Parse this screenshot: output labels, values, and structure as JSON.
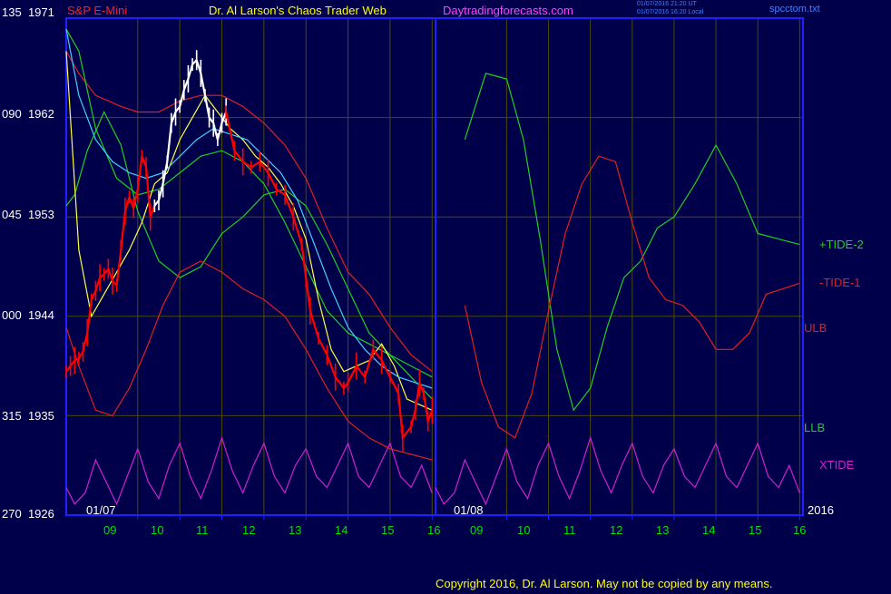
{
  "header": {
    "symbol": "S&P E-Mini",
    "title": "Dr. Al Larson's Chaos Trader Web",
    "site": "Daytradingforecasts.com",
    "timestamp_ut": "01/07/2016 21:20 UT",
    "timestamp_local": "01/07/2016 16:20 Local",
    "file": "spcctom.txt"
  },
  "copyright": "Copyright 2016, Dr. Al Larson. May not be copied by any means.",
  "legend": {
    "tide2": "+TIDE-2",
    "tide1": "-TIDE-1",
    "ulb": "ULB",
    "llb": "LLB",
    "xtide": "XTIDE"
  },
  "colors": {
    "background": "#00004a",
    "frame": "#2020ff",
    "grid": "#4a4a10",
    "price_up": "#ffffff",
    "price_down": "#ff0000",
    "tide2": "#20d020",
    "tide1": "#e02020",
    "xtide": "#d020d0",
    "llb": "#20d020",
    "fast_avg": "#ffff40",
    "slow_avg": "#40d0ff",
    "header_symbol": "#ff2020",
    "header_title": "#ffff00",
    "header_site": "#ff40ff",
    "header_small": "#4080ff"
  },
  "chart_data": {
    "type": "line",
    "title": "S&P E-Mini",
    "y_axis": {
      "range": [
        1926,
        1971
      ],
      "ticks": [
        {
          "left": "135",
          "right": "1971"
        },
        {
          "left": "090",
          "right": "1962"
        },
        {
          "left": "045",
          "right": "1953"
        },
        {
          "left": "000",
          "right": "1944"
        },
        {
          "left": "315",
          "right": "1935"
        },
        {
          "left": "270",
          "right": "1926"
        }
      ]
    },
    "x_axis": {
      "unit": "hour",
      "range": [
        7.3,
        16.08
      ],
      "ticks": [
        {
          "label": "09",
          "x": 9
        },
        {
          "label": "10",
          "x": 10
        },
        {
          "label": "11",
          "x": 11
        },
        {
          "label": "12",
          "x": 12
        },
        {
          "label": "13",
          "x": 13
        },
        {
          "label": "14",
          "x": 14
        },
        {
          "label": "15",
          "x": 15
        },
        {
          "label": "16",
          "x": 16
        },
        {
          "label": "09",
          "x": 9
        },
        {
          "label": "10",
          "x": 10
        },
        {
          "label": "11",
          "x": 11
        },
        {
          "label": "12",
          "x": 12
        },
        {
          "label": "13",
          "x": 13
        },
        {
          "label": "14",
          "x": 14
        },
        {
          "label": "15",
          "x": 15
        },
        {
          "label": "16",
          "x": 16
        }
      ],
      "date_labels": [
        "01/07",
        "01/08",
        "2016"
      ]
    },
    "price_segments": [
      {
        "color": "down",
        "points": [
          [
            7.3,
            1939.0
          ],
          [
            7.4,
            1939.5
          ],
          [
            7.5,
            1940.0
          ],
          [
            7.6,
            1940.2
          ],
          [
            7.7,
            1940.8
          ],
          [
            7.8,
            1942.5
          ],
          [
            7.9,
            1945.5
          ],
          [
            8.0,
            1946.3
          ],
          [
            8.1,
            1947.5
          ],
          [
            8.2,
            1947.8
          ],
          [
            8.3,
            1948.3
          ],
          [
            8.4,
            1947.2
          ],
          [
            8.5,
            1946.8
          ],
          [
            8.6,
            1950.0
          ],
          [
            8.7,
            1953.5
          ],
          [
            8.8,
            1954.8
          ],
          [
            8.9,
            1953.8
          ],
          [
            9.0,
            1955.5
          ],
          [
            9.1,
            1958.5
          ],
          [
            9.2,
            1957.5
          ],
          [
            9.3,
            1953.0
          ],
          [
            9.4,
            1954.0
          ]
        ]
      },
      {
        "color": "up",
        "points": [
          [
            9.4,
            1954.0
          ],
          [
            9.5,
            1954.5
          ],
          [
            9.6,
            1956.0
          ],
          [
            9.7,
            1958.0
          ],
          [
            9.8,
            1961.5
          ],
          [
            9.9,
            1962.5
          ],
          [
            10.0,
            1963.0
          ],
          [
            10.1,
            1964.5
          ],
          [
            10.2,
            1965.5
          ],
          [
            10.3,
            1966.8
          ],
          [
            10.4,
            1967.2
          ],
          [
            10.5,
            1966.0
          ],
          [
            10.6,
            1964.0
          ],
          [
            10.7,
            1962.0
          ],
          [
            10.8,
            1961.5
          ],
          [
            10.9,
            1960.0
          ],
          [
            11.0,
            1961.5
          ],
          [
            11.1,
            1962.5
          ]
        ]
      },
      {
        "color": "down",
        "points": [
          [
            11.1,
            1962.5
          ],
          [
            11.3,
            1959.0
          ],
          [
            11.5,
            1958.0
          ],
          [
            11.7,
            1957.5
          ],
          [
            11.9,
            1958.0
          ],
          [
            12.1,
            1957.0
          ],
          [
            12.3,
            1955.5
          ],
          [
            12.5,
            1955.0
          ],
          [
            12.7,
            1953.0
          ],
          [
            12.9,
            1950.5
          ],
          [
            13.0,
            1947.5
          ],
          [
            13.1,
            1944.5
          ],
          [
            13.3,
            1942.0
          ],
          [
            13.5,
            1940.5
          ],
          [
            13.7,
            1938.5
          ],
          [
            13.9,
            1937.5
          ],
          [
            14.0,
            1938.0
          ],
          [
            14.2,
            1939.5
          ],
          [
            14.4,
            1938.5
          ],
          [
            14.6,
            1941.0
          ],
          [
            14.8,
            1940.0
          ],
          [
            15.0,
            1938.5
          ],
          [
            15.2,
            1937.0
          ],
          [
            15.3,
            1933.0
          ],
          [
            15.5,
            1934.0
          ],
          [
            15.6,
            1935.5
          ],
          [
            15.7,
            1938.0
          ],
          [
            15.8,
            1937.0
          ],
          [
            15.9,
            1934.5
          ],
          [
            16.0,
            1935.5
          ]
        ]
      }
    ],
    "series": [
      {
        "name": "+TIDE-2",
        "color": "tide2",
        "x": [
          7.3,
          7.5,
          7.8,
          8.2,
          8.6,
          9.0,
          9.5,
          10.0,
          10.5,
          11.0,
          11.5,
          12.0,
          12.5,
          13.0,
          13.5,
          14.0,
          14.5,
          15.0,
          15.5,
          16.0
        ],
        "y": [
          1954.0,
          1955.0,
          1959.0,
          1962.5,
          1959.5,
          1953.5,
          1949.0,
          1947.5,
          1948.5,
          1951.5,
          1953.0,
          1955.0,
          1955.5,
          1954.0,
          1950.5,
          1946.5,
          1942.5,
          1940.5,
          1938.5,
          1936.5
        ]
      },
      {
        "name": "-TIDE-1",
        "color": "tide1",
        "x": [
          7.3,
          7.6,
          8.0,
          8.4,
          8.8,
          9.2,
          9.6,
          10.0,
          10.5,
          11.0,
          11.5,
          12.0,
          12.5,
          13.0,
          13.5,
          14.0,
          14.5,
          15.0,
          15.5,
          16.0
        ],
        "y": [
          1943.0,
          1939.5,
          1935.5,
          1935.0,
          1937.5,
          1941.0,
          1945.0,
          1948.0,
          1949.0,
          1948.0,
          1946.5,
          1945.5,
          1944.0,
          1941.0,
          1937.5,
          1934.5,
          1933.0,
          1932.0,
          1931.5,
          1931.0
        ]
      },
      {
        "name": "ULB",
        "color": "tide1",
        "x": [
          7.3,
          7.6,
          8.0,
          8.6,
          9.0,
          9.5,
          10.0,
          10.5,
          11.0,
          11.5,
          12.0,
          12.5,
          13.0,
          13.5,
          14.0,
          14.5,
          15.0,
          15.5,
          16.0
        ],
        "y": [
          1968.0,
          1966.0,
          1964.0,
          1963.0,
          1962.5,
          1962.5,
          1963.5,
          1964.0,
          1964.0,
          1963.0,
          1961.5,
          1959.5,
          1956.5,
          1952.0,
          1948.0,
          1946.0,
          1943.0,
          1940.5,
          1939.0
        ]
      },
      {
        "name": "LLB",
        "color": "llb",
        "x": [
          7.3,
          7.6,
          8.0,
          8.5,
          9.0,
          9.5,
          10.0,
          10.5,
          11.0,
          11.5,
          12.0,
          12.5,
          13.0,
          13.5,
          14.0,
          14.5,
          15.0,
          15.5,
          16.0
        ],
        "y": [
          1970.0,
          1968.0,
          1961.0,
          1956.5,
          1955.0,
          1955.5,
          1957.0,
          1958.5,
          1959.0,
          1958.0,
          1956.0,
          1952.5,
          1948.5,
          1944.5,
          1942.5,
          1941.5,
          1940.5,
          1939.5,
          1938.5
        ]
      },
      {
        "name": "XTIDE",
        "color": "xtide",
        "x": [
          7.3,
          7.5,
          7.75,
          8.0,
          8.25,
          8.5,
          8.75,
          9.0,
          9.25,
          9.5,
          9.75,
          10.0,
          10.25,
          10.5,
          10.75,
          11.0,
          11.25,
          11.5,
          11.75,
          12.0,
          12.25,
          12.5,
          12.75,
          13.0,
          13.25,
          13.5,
          13.75,
          14.0,
          14.25,
          14.5,
          14.75,
          15.0,
          15.25,
          15.5,
          15.75,
          16.0
        ],
        "y": [
          1928.5,
          1927.0,
          1928.0,
          1931.0,
          1929.0,
          1927.0,
          1929.5,
          1932.0,
          1929.0,
          1927.5,
          1930.5,
          1932.5,
          1929.5,
          1927.5,
          1930.0,
          1933.0,
          1930.0,
          1928.0,
          1930.5,
          1932.5,
          1929.5,
          1928.0,
          1930.5,
          1932.0,
          1929.5,
          1928.5,
          1930.5,
          1932.5,
          1929.5,
          1928.5,
          1930.5,
          1932.5,
          1929.5,
          1928.5,
          1930.5,
          1928.0
        ]
      },
      {
        "name": "",
        "color": "fast_avg",
        "x": [
          7.3,
          7.6,
          7.9,
          8.2,
          8.5,
          8.8,
          9.1,
          9.4,
          9.7,
          10.0,
          10.3,
          10.6,
          10.9,
          11.2,
          11.5,
          11.8,
          12.1,
          12.4,
          12.7,
          13.0,
          13.3,
          13.6,
          13.9,
          14.2,
          14.5,
          14.8,
          15.1,
          15.4,
          15.7,
          16.0
        ],
        "y": [
          1968.0,
          1950.0,
          1944.0,
          1946.0,
          1948.0,
          1950.0,
          1952.5,
          1956.0,
          1957.0,
          1960.0,
          1962.0,
          1964.0,
          1962.5,
          1961.0,
          1960.0,
          1958.5,
          1957.5,
          1956.0,
          1954.0,
          1951.0,
          1945.5,
          1941.0,
          1939.0,
          1939.5,
          1940.0,
          1941.5,
          1939.5,
          1936.5,
          1936.0,
          1935.5
        ]
      },
      {
        "name": "",
        "color": "slow_avg",
        "x": [
          7.3,
          7.6,
          8.0,
          8.4,
          8.8,
          9.2,
          9.6,
          10.0,
          10.4,
          10.8,
          11.2,
          11.6,
          12.0,
          12.4,
          12.8,
          13.2,
          13.6,
          14.0,
          14.4,
          14.8,
          15.2,
          15.6,
          16.0
        ],
        "y": [
          1970.0,
          1964.0,
          1960.0,
          1958.0,
          1957.0,
          1956.5,
          1957.0,
          1958.5,
          1960.0,
          1961.0,
          1960.5,
          1960.0,
          1958.5,
          1957.0,
          1954.5,
          1950.5,
          1946.5,
          1943.0,
          1941.0,
          1939.5,
          1938.5,
          1938.0,
          1937.5
        ]
      }
    ],
    "projection": [
      {
        "name": "+TIDE-2",
        "color": "tide2",
        "x": [
          8.0,
          8.5,
          9.0,
          9.4,
          9.8,
          10.2,
          10.6,
          11.0,
          11.4,
          11.8,
          12.2,
          12.6,
          13.0,
          13.5,
          14.0,
          14.5,
          15.0,
          15.5,
          16.0
        ],
        "y": [
          1960.0,
          1966.0,
          1965.5,
          1960.0,
          1951.0,
          1941.0,
          1935.5,
          1937.5,
          1943.0,
          1947.5,
          1949.0,
          1952.0,
          1953.0,
          1956.0,
          1959.5,
          1956.0,
          1951.5,
          1951.0,
          1950.5
        ]
      },
      {
        "name": "-TIDE-1",
        "color": "tide1",
        "x": [
          8.0,
          8.4,
          8.8,
          9.2,
          9.6,
          10.0,
          10.4,
          10.8,
          11.2,
          11.6,
          12.0,
          12.4,
          12.8,
          13.2,
          13.6,
          14.0,
          14.4,
          14.8,
          15.2,
          15.6,
          16.0
        ],
        "y": [
          1945.0,
          1938.0,
          1934.0,
          1933.0,
          1937.0,
          1944.5,
          1951.5,
          1956.0,
          1958.5,
          1958.0,
          1952.5,
          1947.5,
          1945.5,
          1945.0,
          1943.5,
          1941.0,
          1941.0,
          1942.5,
          1946.0,
          1946.5,
          1947.0
        ]
      }
    ]
  }
}
